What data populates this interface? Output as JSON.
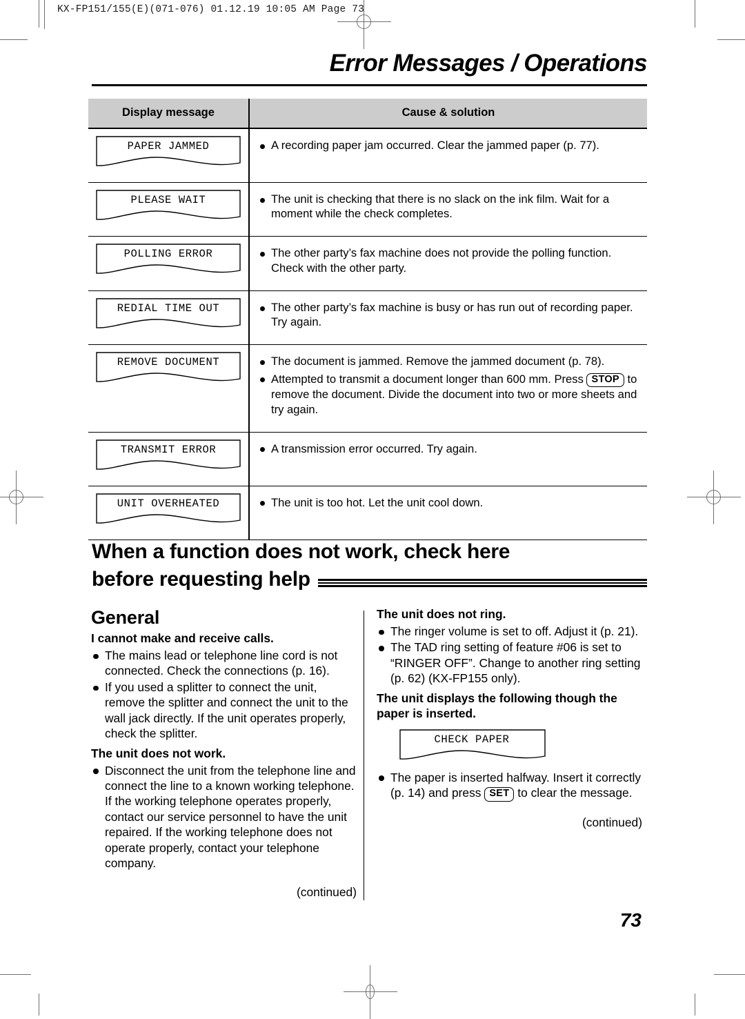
{
  "slug": "KX-FP151/155(E)(071-076)  01.12.19  10:05 AM  Page 73",
  "chapter_title": "Error Messages / Operations",
  "folio": "73",
  "table": {
    "headers": [
      "Display message",
      "Cause & solution"
    ],
    "rows": [
      {
        "display": "PAPER JAMMED",
        "items": [
          {
            "text": "A recording paper jam occurred. Clear the jammed paper (p. 77)."
          }
        ]
      },
      {
        "display": "PLEASE WAIT",
        "items": [
          {
            "text": "The unit is checking that there is no slack on the ink film. Wait for a moment while the check completes."
          }
        ]
      },
      {
        "display": "POLLING ERROR",
        "items": [
          {
            "text": "The other party’s fax machine does not provide the polling function. Check with the other party."
          }
        ]
      },
      {
        "display": "REDIAL TIME OUT",
        "items": [
          {
            "text": "The other party’s fax machine is busy or has run out of recording paper. Try again."
          }
        ]
      },
      {
        "display": "REMOVE DOCUMENT",
        "items": [
          {
            "text": "The document is jammed. Remove the jammed document (p. 78)."
          },
          {
            "text_before": "Attempted to transmit a document longer than 600 mm. Press ",
            "key": "STOP",
            "text_after": " to remove the document. Divide the document into two or more sheets and try again."
          }
        ]
      },
      {
        "display": "TRANSMIT ERROR",
        "items": [
          {
            "text": "A transmission error occurred. Try again."
          }
        ]
      },
      {
        "display": "UNIT OVERHEATED",
        "items": [
          {
            "text": "The unit is too hot. Let the unit cool down."
          }
        ]
      }
    ]
  },
  "section": {
    "heading_line1": "When a function does not work, check here",
    "heading_line2": "before requesting help"
  },
  "left_column": {
    "subhead": "General",
    "q1": "I cannot make and receive calls.",
    "a1a": "The mains lead or telephone line cord is not connected. Check the connections (p. 16).",
    "a1b": "If you used a splitter to connect the unit, remove the splitter and connect the unit to the wall jack directly. If the unit operates properly, check the splitter.",
    "q2": "The unit does not work.",
    "a2a": "Disconnect the unit from the telephone line and connect the line to a known working telephone. If the working telephone operates properly, contact our service personnel to have the unit repaired. If the working telephone does not operate properly, contact your telephone company.",
    "continued": "(continued)"
  },
  "right_column": {
    "q1": "The unit does not ring.",
    "a1a": "The ringer volume is set to off. Adjust it (p. 21).",
    "a1b": "The TAD ring setting of feature #06 is set to “RINGER OFF”. Change to another ring setting (p. 62) (KX-FP155 only).",
    "q2": "The unit displays the following though the paper is inserted.",
    "lcd": "CHECK PAPER",
    "a2_before": "The paper is inserted halfway. Insert it correctly (p. 14) and press ",
    "a2_key": "SET",
    "a2_after": " to clear the message.",
    "continued": "(continued)"
  },
  "colors": {
    "header_fill": "#cccccc",
    "rule": "#000000",
    "mark": "#6e6e6e"
  }
}
